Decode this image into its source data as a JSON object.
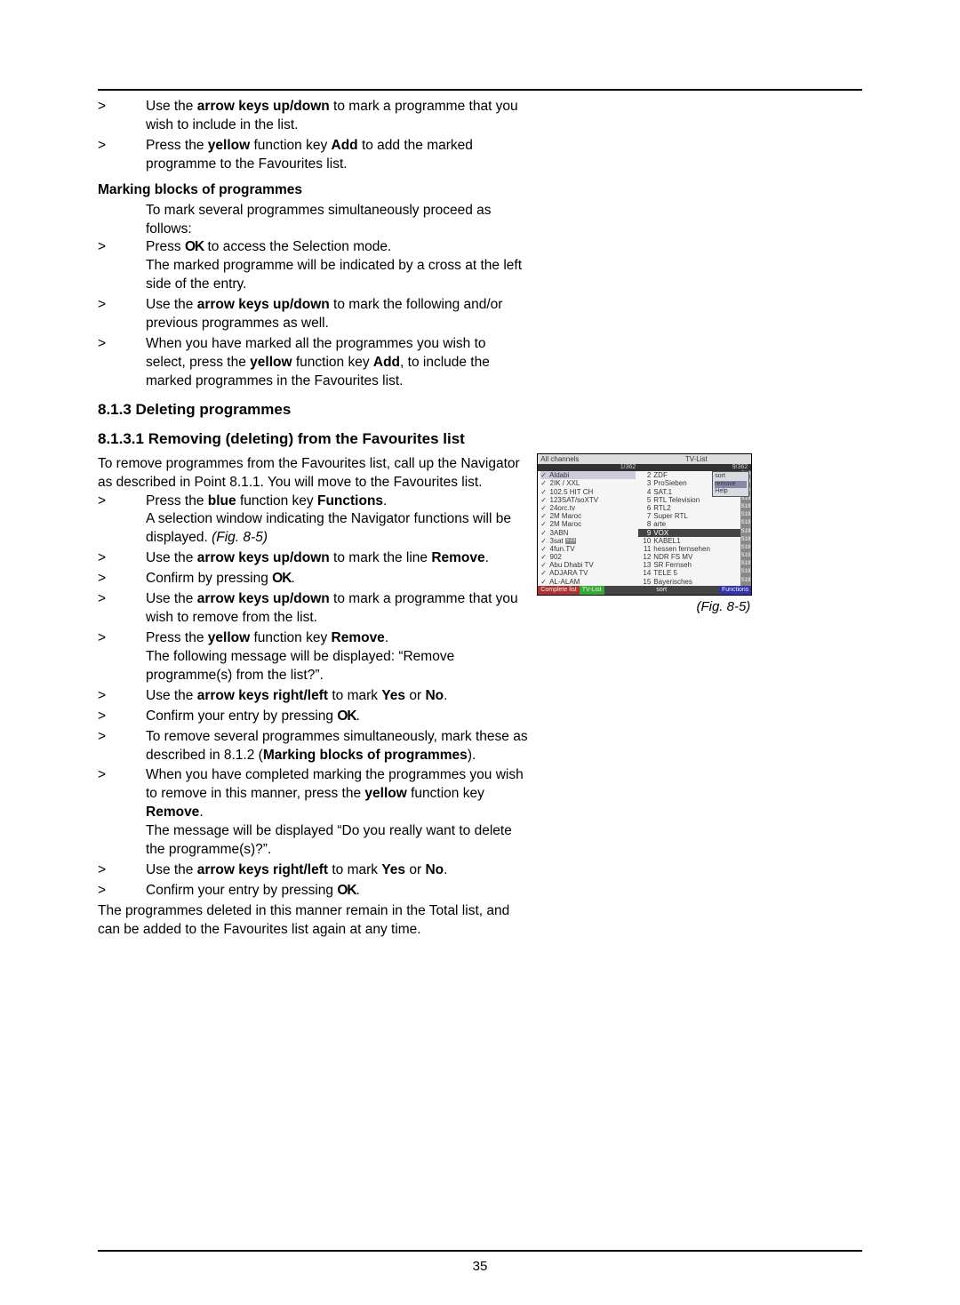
{
  "page_number": "35",
  "steps_a": [
    {
      "marker": ">",
      "pre": "Use the ",
      "b1": "arrow keys up/down",
      "mid": " to mark a programme that you wish to include in the list."
    },
    {
      "marker": ">",
      "pre": "Press the ",
      "b1": "yellow",
      "mid": " function key ",
      "b2": "Add",
      "post": " to add the marked programme to the Favourites list."
    }
  ],
  "marking_head": "Marking blocks of programmes",
  "marking_intro": "To mark several programmes simultaneously proceed as follows:",
  "steps_b": [
    {
      "marker": ">",
      "pre": "Press ",
      "ok": "OK",
      "post": " to access the Selection mode.",
      "extra": "The marked programme will be indicated by a cross at the left side of the entry."
    },
    {
      "marker": ">",
      "pre": "Use the ",
      "b1": "arrow keys up/down",
      "post": " to mark the following and/or previous programmes as well."
    },
    {
      "marker": ">",
      "pre": "When you have marked all the programmes you wish to select, press the ",
      "b1": "yellow",
      "mid": " function key ",
      "b2": "Add",
      "post": ", to include the marked programmes in the Favourites list."
    }
  ],
  "h813": "8.1.3 Deleting programmes",
  "h8131": "8.1.3.1 Removing (deleting) from the Favourites list",
  "remove_intro": "To remove programmes from the Favourites list, call up the Navigator as described in Point 8.1.1. You will move to the Favourites list.",
  "steps_c": [
    {
      "marker": ">",
      "pre": "Press the ",
      "b1": "blue",
      "mid": " function key ",
      "b2": "Functions",
      "post": ".",
      "extra": "A selection window indicating the Navigator functions will be displayed. ",
      "fig": "(Fig. 8-5)"
    },
    {
      "marker": ">",
      "pre": "Use the ",
      "b1": "arrow keys up/down",
      "post": " to mark the line ",
      "b2": "Remove",
      "post2": "."
    },
    {
      "marker": ">",
      "pre": "Confirm by pressing ",
      "ok": "OK",
      "post": "."
    },
    {
      "marker": ">",
      "pre": "Use the ",
      "b1": "arrow keys up/down",
      "post": " to mark a programme that you wish to remove from the list."
    },
    {
      "marker": ">",
      "pre": "Press the ",
      "b1": "yellow",
      "mid": " function key ",
      "b2": "Remove",
      "post": ".",
      "extra": "The following message will be displayed: “Remove programme(s) from the list?”."
    },
    {
      "marker": ">",
      "pre": "Use the ",
      "b1": "arrow keys right/left",
      "mid": " to mark ",
      "b2": "Yes",
      "mid2": " or ",
      "b3": "No",
      "post": "."
    },
    {
      "marker": ">",
      "pre": "Confirm your entry by pressing ",
      "ok": "OK",
      "post": "."
    },
    {
      "marker": ">",
      "pre": "To remove several programmes simultaneously, mark these as described in 8.1.2 (",
      "b1": "Marking blocks of programmes",
      "post": ")."
    },
    {
      "marker": ">",
      "pre": "When you have completed marking the programmes you wish to remove in this manner, press the ",
      "b1": "yellow",
      "post": " function key ",
      "b2": "Remove",
      "post2": ".",
      "extra": "The message will be displayed “Do you really want to delete the programme(s)?”."
    },
    {
      "marker": ">",
      "pre": "Use the ",
      "b1": "arrow keys right/left",
      "mid": " to mark ",
      "b2": "Yes",
      "mid2": " or ",
      "b3": "No",
      "post": "."
    },
    {
      "marker": ">",
      "pre": "Confirm your entry by pressing ",
      "ok": "OK",
      "post": "."
    }
  ],
  "closing": "The programmes deleted in this manner remain in the Total list, and can be added to the Favourites list again at any time.",
  "fig": {
    "caption": "(Fig. 8-5)",
    "hdr_left": "All channels",
    "hdr_right": "TV-List",
    "count_left": "1/362",
    "count_right": "9/362",
    "left_rows": [
      "Aldabi",
      "2IK / XXL",
      "102.5 HIT CH",
      "123SAT/soXTV",
      "24orc.tv",
      "2M Maroc",
      "2M Maroc",
      "3ABN",
      "3sat",
      "4fun.TV",
      "902",
      "Abu Dhabi TV",
      "ADJARA TV",
      "AL-ALAM"
    ],
    "right_rows": [
      {
        "n": "2",
        "t": "ZDF"
      },
      {
        "n": "3",
        "t": "ProSieben"
      },
      {
        "n": "4",
        "t": "SAT.1"
      },
      {
        "n": "5",
        "t": "RTL Television"
      },
      {
        "n": "6",
        "t": "RTL2"
      },
      {
        "n": "7",
        "t": "Super RTL"
      },
      {
        "n": "8",
        "t": "arte"
      },
      {
        "n": "9",
        "t": "VOX"
      },
      {
        "n": "10",
        "t": "KABEL1"
      },
      {
        "n": "11",
        "t": "hessen fernsehen"
      },
      {
        "n": "12",
        "t": "NDR FS MV"
      },
      {
        "n": "13",
        "t": "SR Fernseh"
      },
      {
        "n": "14",
        "t": "TELE 5"
      },
      {
        "n": "15",
        "t": "Bayerisches"
      }
    ],
    "popup": [
      "sort",
      "remove",
      "Help"
    ],
    "ftr": [
      "Complete list",
      "TV-List",
      "sort",
      "Functions"
    ]
  }
}
